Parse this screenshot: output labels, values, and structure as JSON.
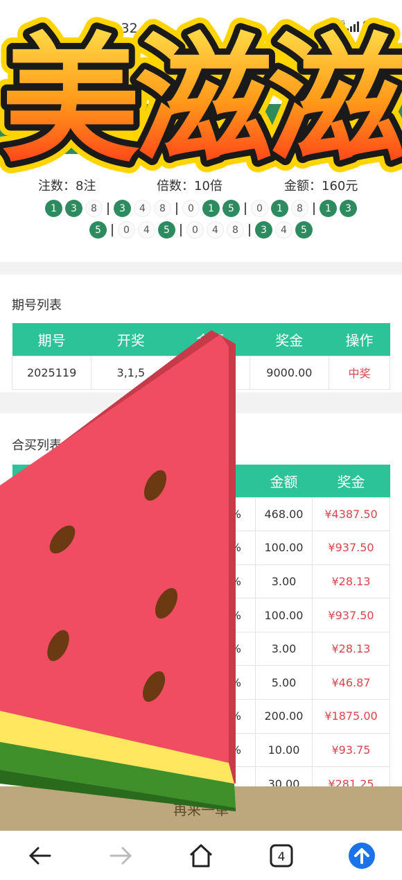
{
  "status": {
    "time": "9:32",
    "network": "5G"
  },
  "banner": {
    "text": "美滋滋"
  },
  "summary": {
    "bets_label": "注数：",
    "bets_value": "8注",
    "multiple_label": "倍数：",
    "multiple_value": "10倍",
    "amount_label": "金额：",
    "amount_value": "160元"
  },
  "numbers": {
    "row1": [
      {
        "n": "1",
        "hit": true
      },
      {
        "n": "3",
        "hit": true
      },
      {
        "n": "8",
        "hit": false
      },
      {
        "sep": true
      },
      {
        "n": "3",
        "hit": true
      },
      {
        "n": "4",
        "hit": false
      },
      {
        "n": "8",
        "hit": false
      },
      {
        "sep": true
      },
      {
        "n": "0",
        "hit": false
      },
      {
        "n": "1",
        "hit": true
      },
      {
        "n": "5",
        "hit": true
      },
      {
        "sep": true
      },
      {
        "n": "0",
        "hit": false
      },
      {
        "n": "1",
        "hit": true
      },
      {
        "n": "8",
        "hit": false
      },
      {
        "sep": true
      },
      {
        "n": "1",
        "hit": true
      },
      {
        "n": "3",
        "hit": true
      }
    ],
    "row2": [
      {
        "n": "5",
        "hit": true
      },
      {
        "sep": true
      },
      {
        "n": "0",
        "hit": false
      },
      {
        "n": "4",
        "hit": false
      },
      {
        "n": "5",
        "hit": true
      },
      {
        "sep": true
      },
      {
        "n": "0",
        "hit": false
      },
      {
        "n": "4",
        "hit": false
      },
      {
        "n": "8",
        "hit": false
      },
      {
        "sep": true
      },
      {
        "n": "3",
        "hit": true
      },
      {
        "n": "4",
        "hit": false
      },
      {
        "n": "5",
        "hit": true
      }
    ]
  },
  "issues": {
    "title": "期号列表",
    "headers": [
      "期号",
      "开奖",
      "金额",
      "奖金",
      "操作"
    ],
    "rows": [
      {
        "issue": "2025119",
        "draw": "3,1,5",
        "amount": "",
        "prize": "9000.00",
        "action": "中奖"
      }
    ]
  },
  "joint": {
    "title": "合买列表",
    "headers": [
      "",
      "",
      "",
      "金额",
      "奖金"
    ],
    "rows": [
      {
        "pct": "%",
        "amount": "468.00",
        "prize": "¥4387.50"
      },
      {
        "pct": "%",
        "amount": "100.00",
        "prize": "¥937.50"
      },
      {
        "pct": "%",
        "amount": "3.00",
        "prize": "¥28.13"
      },
      {
        "pct": "%",
        "amount": "100.00",
        "prize": "¥937.50"
      },
      {
        "pct": "%",
        "amount": "3.00",
        "prize": "¥28.13"
      },
      {
        "pct": "%",
        "amount": "5.00",
        "prize": "¥46.87"
      },
      {
        "pct": "%",
        "amount": "200.00",
        "prize": "¥1875.00"
      },
      {
        "pct": "%",
        "amount": "10.00",
        "prize": "¥93.75"
      },
      {
        "pct": "",
        "amount": "30.00",
        "prize": "¥281.25"
      }
    ]
  },
  "action": {
    "label": "再来一单"
  },
  "nav": {
    "tabs_count": "4"
  },
  "colors": {
    "hit_ball": "#2e8b60",
    "table_header": "#2cc399",
    "prize_red": "#d9464b",
    "action_bar": "#bda77c"
  },
  "icons": [
    "back-arrow-icon",
    "forward-arrow-icon",
    "home-icon",
    "tabs-icon",
    "scroll-top-icon",
    "watermelon-sticker",
    "signal-icon",
    "battery-icon"
  ]
}
